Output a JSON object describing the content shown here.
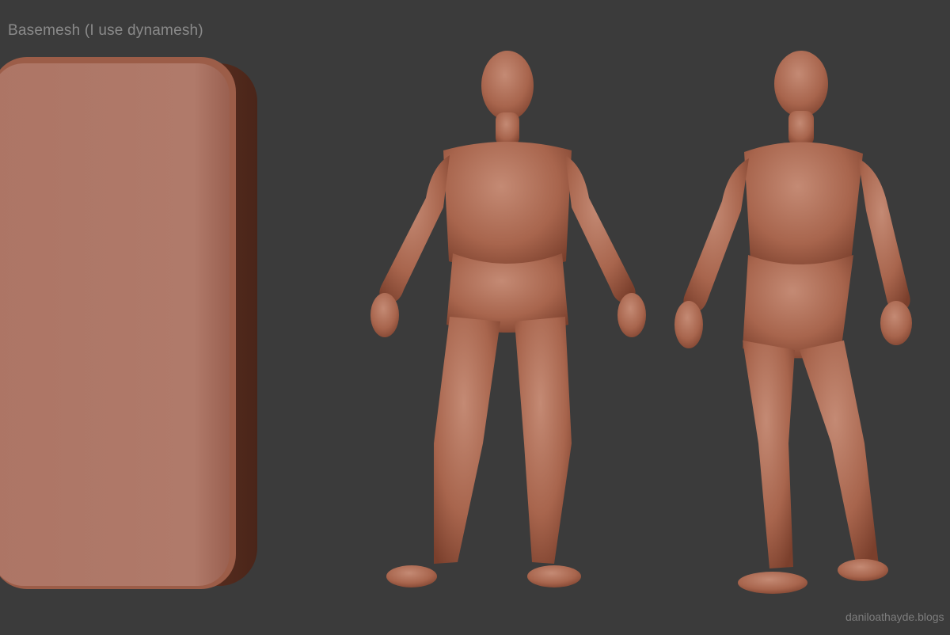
{
  "caption": "Basemesh (I use dynamesh)",
  "watermark": "daniloathayde.blogs",
  "colors": {
    "background": "#3b3b3b",
    "clay": "#b26e56",
    "clay_dark": "#7a3f2c",
    "clay_light": "#c48a74"
  }
}
